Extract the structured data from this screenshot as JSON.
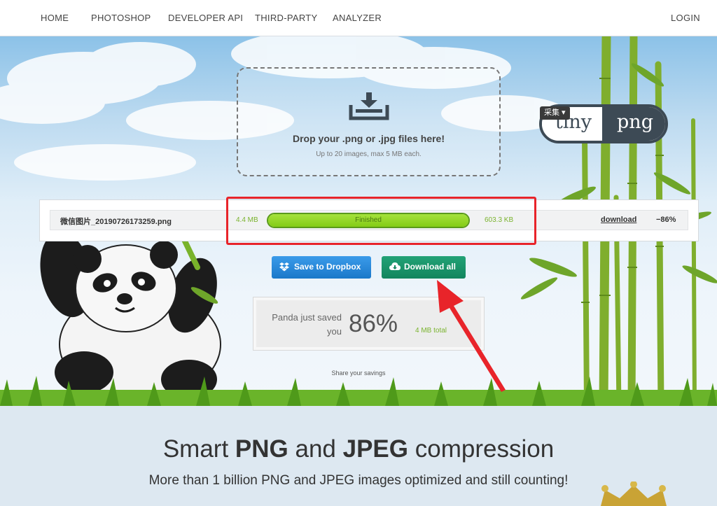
{
  "nav": {
    "items": [
      "HOME",
      "PHOTOSHOP",
      "DEVELOPER API",
      "THIRD-PARTY",
      "ANALYZER"
    ],
    "login": "LOGIN"
  },
  "dropzone": {
    "title": "Drop your .png or .jpg files here!",
    "subtitle": "Up to 20 images, max 5 MB each."
  },
  "logo": {
    "left": "tiny",
    "right": "png"
  },
  "overlay": {
    "caiji": "采集 ▾"
  },
  "file": {
    "name": "微信图片_20190726173259.png",
    "original_size": "4.4 MB",
    "status": "Finished",
    "progress": 1.0,
    "new_size": "603.3 KB",
    "download": "download",
    "saved": "−86%"
  },
  "actions": {
    "dropbox": "Save to Dropbox",
    "download_all": "Download all"
  },
  "savings": {
    "label": "Panda just saved you",
    "percent": "86%",
    "total": "4 MB total",
    "share": "Share your savings"
  },
  "headline": {
    "prefix": "Smart ",
    "png": "PNG",
    "mid": " and ",
    "jpeg": "JPEG",
    "suffix": " compression"
  },
  "subhead": "More than 1 billion PNG and JPEG images optimized and still counting!",
  "colors": {
    "accent_green": "#84cc16",
    "dropbox_blue": "#1b78c9",
    "download_green": "#12855d",
    "annotation_red": "#e8242a"
  }
}
